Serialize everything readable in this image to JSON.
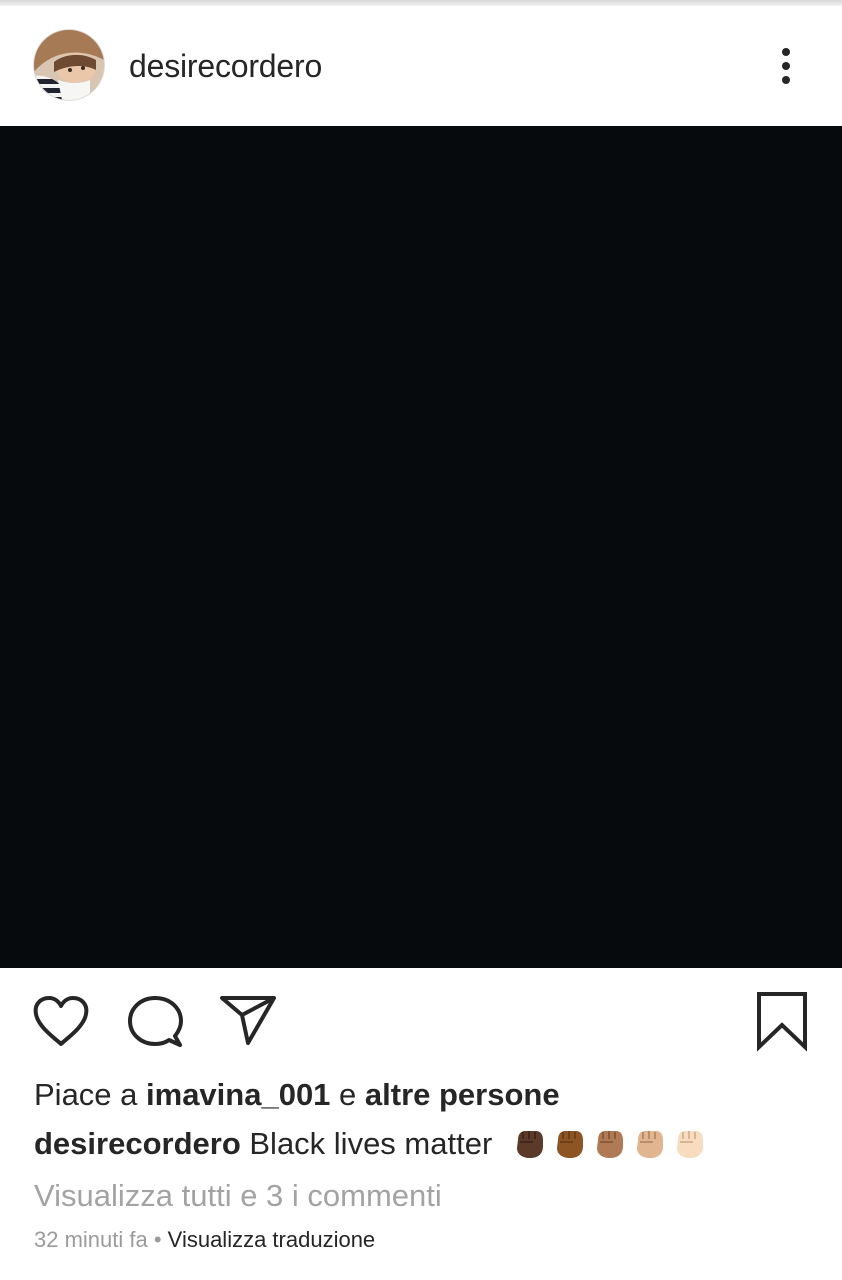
{
  "post": {
    "username": "desirecordero",
    "likes": {
      "prefix": "Piace a ",
      "liked_by": "imavina_001",
      "connector": " e ",
      "others": "altre persone"
    },
    "caption": {
      "author": "desirecordero",
      "text": " Black lives matter",
      "emoji": [
        "raised-fist-dark",
        "raised-fist-medium-dark",
        "raised-fist-medium",
        "raised-fist-medium-light",
        "raised-fist-light"
      ]
    },
    "view_comments": "Visualizza tutti e 3 i commenti",
    "timestamp": "32 minuti fa",
    "separator": " • ",
    "translate": "Visualizza traduzione"
  },
  "icons": {
    "more": "more-vertical-icon",
    "like": "heart-icon",
    "comment": "comment-icon",
    "share": "paper-plane-icon",
    "save": "bookmark-icon"
  },
  "colors": {
    "text": "#262626",
    "muted": "#9b9b9b",
    "image_background": "#070a0d",
    "fist_tones": [
      "#5b3a29",
      "#8d5524",
      "#b07b54",
      "#e0b58f",
      "#f7dcbf"
    ]
  }
}
